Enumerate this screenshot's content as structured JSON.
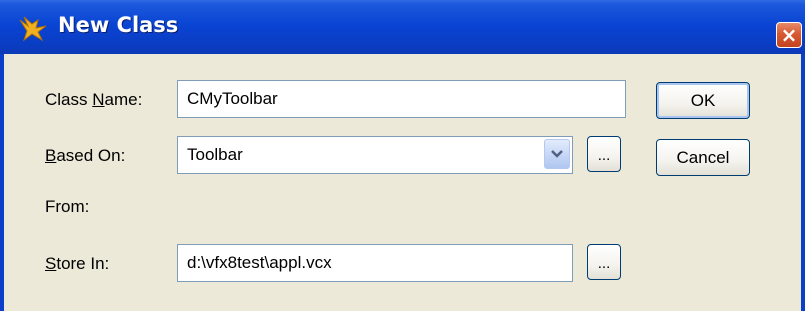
{
  "window": {
    "title": "New Class",
    "close_glyph": "×",
    "title_icon": "vfp-class-icon"
  },
  "fields": {
    "class_name": {
      "label_prefix": "Class ",
      "label_hotkey": "N",
      "label_suffix": "ame:",
      "value": "CMyToolbar"
    },
    "based_on": {
      "label_hotkey": "B",
      "label_suffix": "ased On:",
      "value": "Toolbar",
      "browse_label": "..."
    },
    "from": {
      "label": "From:"
    },
    "store_in": {
      "label_hotkey": "S",
      "label_suffix": "tore In:",
      "value": "d:\\vfx8test\\appl.vcx",
      "browse_label": "..."
    }
  },
  "buttons": {
    "ok": "OK",
    "cancel": "Cancel"
  },
  "colors": {
    "titlebar": "#0a44d4",
    "window_bg": "#ece9d8",
    "close": "#d65a33"
  }
}
